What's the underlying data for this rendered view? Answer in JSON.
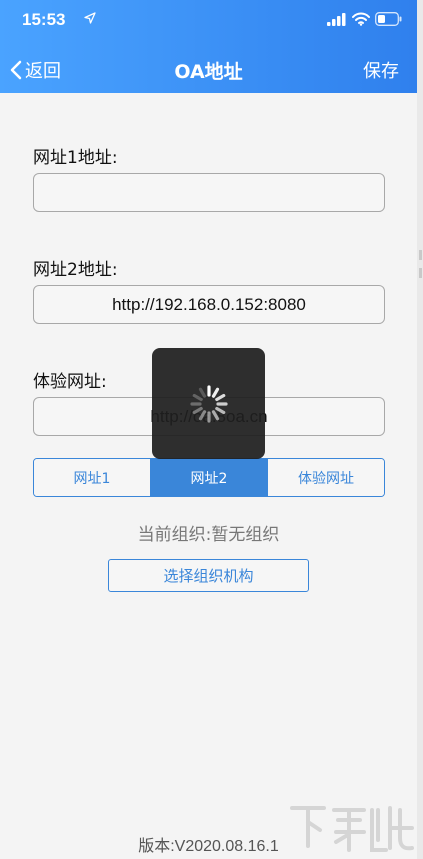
{
  "status_bar": {
    "time": "15:53",
    "icons": [
      "location-arrow-icon",
      "signal-icon",
      "wifi-icon",
      "battery-icon"
    ]
  },
  "nav": {
    "back_label": "返回",
    "title": "OA地址",
    "save_label": "保存"
  },
  "fields": [
    {
      "label": "网址1地址:",
      "value": ""
    },
    {
      "label": "网址2地址:",
      "value": "http://192.168.0.152:8080"
    },
    {
      "label": "体验网址:",
      "value": "http://oa.8oa.cn"
    }
  ],
  "segments": {
    "items": [
      "网址1",
      "网址2",
      "体验网址"
    ],
    "selected": "网址2"
  },
  "org": {
    "current_text": "当前组织:暂无组织",
    "select_button": "选择组织机构"
  },
  "loading": {
    "visible": true,
    "icon": "spinner-icon"
  },
  "footer": {
    "version": "版本:V2020.08.16.1"
  },
  "colors": {
    "header_start": "#4aa3ff",
    "header_end": "#2f80ed",
    "accent": "#3a86d9",
    "background": "#f4f4f4"
  }
}
